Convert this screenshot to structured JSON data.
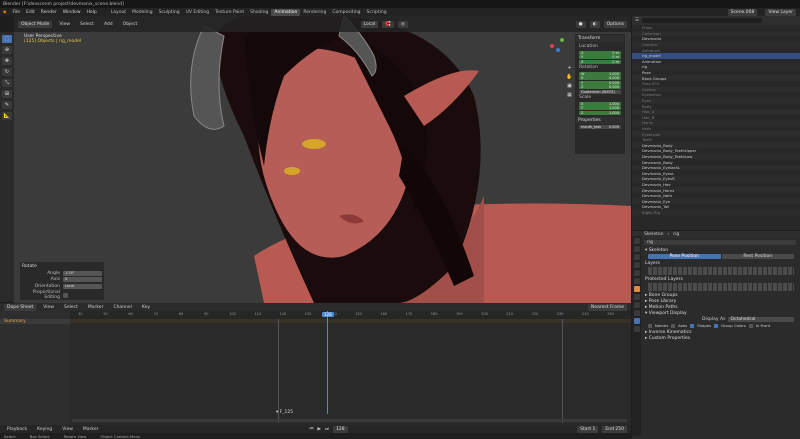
{
  "window": {
    "title": "Blender [F:\\devscene\\ project\\devmanix_scene.blend]"
  },
  "menu": {
    "items": [
      "File",
      "Edit",
      "Render",
      "Window",
      "Help"
    ],
    "workspaces": [
      "Layout",
      "Modeling",
      "Sculpting",
      "UV Editing",
      "Texture Paint",
      "Shading",
      "Animation",
      "Rendering",
      "Compositing",
      "Scripting"
    ],
    "active_workspace": "Animation",
    "scene": "Scene.008",
    "view_layer": "View Layer"
  },
  "viewport": {
    "mode": "Object Mode",
    "menus": [
      "View",
      "Select",
      "Add",
      "Object"
    ],
    "view_label": "User Perspective",
    "collection_label": "(125) Objects | rig_model",
    "transform_orientation": "Local",
    "options_label": "Options"
  },
  "npanel": {
    "transform_title": "Transform",
    "location_label": "Location",
    "location": [
      {
        "axis": "X",
        "value": "0 m"
      },
      {
        "axis": "Y",
        "value": "0 m"
      },
      {
        "axis": "Z",
        "value": "0 m"
      }
    ],
    "rotation_label": "Rotation",
    "rotation": [
      {
        "axis": "W",
        "value": "1.000"
      },
      {
        "axis": "X",
        "value": "0.000"
      },
      {
        "axis": "Y",
        "value": "0.000"
      },
      {
        "axis": "Z",
        "value": "0.000"
      }
    ],
    "rotation_mode": "Quaternion (WXYZ)",
    "scale_label": "Scale",
    "scale": [
      {
        "axis": "X",
        "value": "1.000"
      },
      {
        "axis": "Y",
        "value": "1.000"
      },
      {
        "axis": "Z",
        "value": "1.000"
      }
    ],
    "properties_title": "Properties",
    "prop_name": "mouth_test",
    "prop_value": "0.000"
  },
  "last_op": {
    "title": "Rotate",
    "rows": [
      {
        "label": "Angle",
        "value": "1.35°"
      },
      {
        "label": "Axis",
        "value": "X"
      },
      {
        "label": "Orientation",
        "value": "Local"
      },
      {
        "label": "Proportional Editing",
        "value": ""
      }
    ]
  },
  "dopesheet": {
    "editor": "Dope Sheet",
    "menus": [
      "View",
      "Select",
      "Marker",
      "Channel",
      "Key"
    ],
    "sort_label": "Nearest Frame",
    "channel": "Summary",
    "frames": [
      "40",
      "50",
      "60",
      "70",
      "80",
      "90",
      "100",
      "110",
      "120",
      "130",
      "140",
      "150",
      "160",
      "170",
      "180",
      "190",
      "200",
      "210",
      "220",
      "230",
      "240",
      "250",
      "260",
      "270"
    ],
    "current_frame": "128",
    "marker": "F_125"
  },
  "playback": {
    "menus": [
      "Playback",
      "Keying",
      "View",
      "Marker"
    ],
    "start_label": "Start",
    "start": "1",
    "end_label": "End",
    "end": "250"
  },
  "status": {
    "left": "Select",
    "mid1": "Box Select",
    "mid2": "Rotate View",
    "mid3": "Object Context Menu",
    "right": "Devmanix.blend | 2.91 | Mem: 4.64 GiB | 2.91.0"
  },
  "outliner": {
    "rows": [
      {
        "t": "Props",
        "c": "dim"
      },
      {
        "t": "Collection",
        "c": "dim"
      },
      {
        "t": "Devmanix",
        "c": ""
      },
      {
        "t": "Camera",
        "c": "dim"
      },
      {
        "t": "Armature",
        "c": "dim"
      },
      {
        "t": "rig_model",
        "c": "sel"
      },
      {
        "t": "Animation",
        "c": ""
      },
      {
        "t": "rig",
        "c": ""
      },
      {
        "t": "Pose",
        "c": ""
      },
      {
        "t": "Bone Groups",
        "c": ""
      },
      {
        "t": "Pose.001",
        "c": "dim"
      },
      {
        "t": "Outline",
        "c": "dim"
      },
      {
        "t": "Eyelashes",
        "c": "dim"
      },
      {
        "t": "Eyes",
        "c": "dim"
      },
      {
        "t": "Body",
        "c": "dim"
      },
      {
        "t": "Hair_A",
        "c": "dim"
      },
      {
        "t": "Hair_B",
        "c": "dim"
      },
      {
        "t": "Horns",
        "c": "dim"
      },
      {
        "t": "Nails",
        "c": "dim"
      },
      {
        "t": "Eyebrows",
        "c": "dim"
      },
      {
        "t": "Teeth",
        "c": "dim"
      },
      {
        "t": "Devmanix_Body",
        "c": ""
      },
      {
        "t": "Devmanix_Body_TeethUpper",
        "c": ""
      },
      {
        "t": "Devmanix_Body_TeethLow",
        "c": ""
      },
      {
        "t": "Devmanix_Body",
        "c": ""
      },
      {
        "t": "Devmanix_EyelashL",
        "c": ""
      },
      {
        "t": "Devmanix_EyesL",
        "c": ""
      },
      {
        "t": "Devmanix_EyesR",
        "c": ""
      },
      {
        "t": "Devmanix_Hair",
        "c": ""
      },
      {
        "t": "Devmanix_Horns",
        "c": ""
      },
      {
        "t": "Devmanix_Nails",
        "c": ""
      },
      {
        "t": "Devmanix_Eye",
        "c": ""
      },
      {
        "t": "Devmanix_Tail",
        "c": ""
      },
      {
        "t": "Rigify Rig",
        "c": "dim"
      }
    ]
  },
  "properties": {
    "breadcrumb1": "Skeleton",
    "breadcrumb2": "rig",
    "object_name": "rig",
    "skeleton_title": "Skeleton",
    "pose_btn": "Pose Position",
    "rest_btn": "Rest Position",
    "layers_title": "Layers",
    "protected_title": "Protected Layers",
    "bone_groups": "Bone Groups",
    "pose_library": "Pose Library",
    "motion_paths": "Motion Paths",
    "viewport_display": "Viewport Display",
    "display_as_label": "Display As",
    "display_as": "Octahedral",
    "show_names": "Names",
    "show_axes": "Axes",
    "show_shapes": "Shapes",
    "show_group_colors": "Group Colors",
    "show_in_front": "In Front",
    "inverse_kinematics": "Inverse Kinematics",
    "custom_properties": "Custom Properties"
  }
}
